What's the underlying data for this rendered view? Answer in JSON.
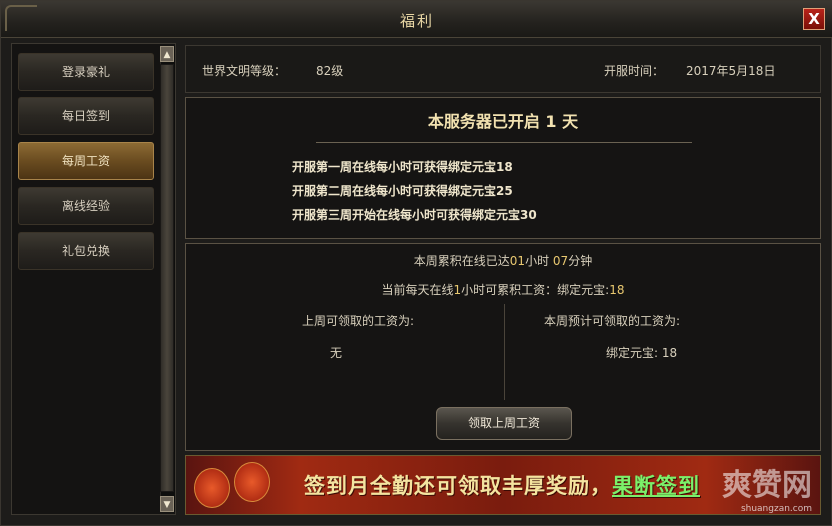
{
  "window": {
    "title": "福利",
    "close_label": "X"
  },
  "sidebar": {
    "items": [
      {
        "label": "登录豪礼",
        "active": false
      },
      {
        "label": "每日签到",
        "active": false
      },
      {
        "label": "每周工资",
        "active": true
      },
      {
        "label": "离线经验",
        "active": false
      },
      {
        "label": "礼包兑换",
        "active": false
      }
    ],
    "scroll_up": "▲",
    "scroll_down": "▼"
  },
  "info": {
    "level_label": "世界文明等级：",
    "level_value": "82级",
    "open_label": "开服时间：",
    "open_value": "2017年5月18日"
  },
  "server": {
    "heading_prefix": "本服务器已开启",
    "heading_days": "1",
    "heading_unit": "天",
    "lines": [
      {
        "text": "开服第一周在线每小时可获得绑定元宝",
        "amount": "18"
      },
      {
        "text": "开服第二周在线每小时可获得绑定元宝",
        "amount": "25"
      },
      {
        "text": "开服第三周开始在线每小时可获得绑定元宝",
        "amount": "30"
      }
    ]
  },
  "wage": {
    "accum_prefix": "本周累积在线已达",
    "accum_hours": "01",
    "accum_hours_unit": "小时",
    "accum_minutes": "07",
    "accum_minutes_unit": "分钟",
    "current_prefix": "当前每天在线",
    "current_hours": "1",
    "current_mid": "小时可累积工资：绑定元宝:",
    "current_value": "18",
    "last_week_label": "上周可领取的工资为:",
    "last_week_value": "无",
    "this_week_label": "本周预计可领取的工资为:",
    "this_week_value": "绑定元宝: 18",
    "claim_button": "领取上周工资"
  },
  "banner": {
    "text": "签到月全勤还可领取丰厚奖励，",
    "link": "果断签到",
    "watermark": "爽赞网",
    "watermark_url": "shuangzan.com"
  },
  "colors": {
    "accent": "#e8c870",
    "active_tab": "#8c6a34",
    "link": "#7cf06a"
  }
}
